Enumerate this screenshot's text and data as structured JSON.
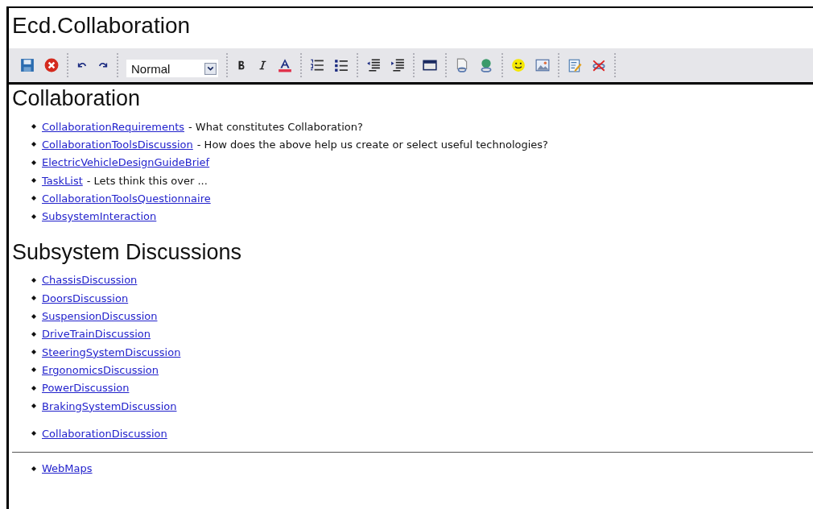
{
  "title": "Ecd.Collaboration",
  "toolbar": [
    [
      {
        "kind": "save"
      },
      {
        "kind": "cancel"
      }
    ],
    [
      {
        "kind": "undo"
      },
      {
        "kind": "redo"
      }
    ],
    [
      {
        "kind": "select",
        "value": "Normal"
      }
    ],
    [
      {
        "kind": "bold"
      },
      {
        "kind": "italic"
      },
      {
        "kind": "color"
      }
    ],
    [
      {
        "kind": "ordered"
      },
      {
        "kind": "unordered"
      }
    ],
    [
      {
        "kind": "outdent"
      },
      {
        "kind": "indent"
      }
    ],
    [
      {
        "kind": "table"
      }
    ],
    [
      {
        "kind": "link"
      },
      {
        "kind": "weblink"
      }
    ],
    [
      {
        "kind": "smiley"
      },
      {
        "kind": "image"
      }
    ],
    [
      {
        "kind": "edit"
      },
      {
        "kind": "unlink"
      }
    ]
  ],
  "sections": [
    {
      "heading": "Collaboration",
      "lists": [
        [
          {
            "link": "CollaborationRequirements",
            "description": "- What constitutes Collaboration?"
          },
          {
            "link": "CollaborationToolsDiscussion",
            "description": "- How does the above help us create or select useful technologies?"
          },
          {
            "link": "ElectricVehicleDesignGuideBrief"
          },
          {
            "link": "TaskList",
            "description": "- Lets think this over ..."
          },
          {
            "link": "CollaborationToolsQuestionnaire"
          },
          {
            "link": "SubsystemInteraction"
          }
        ]
      ]
    },
    {
      "heading": "Subsystem Discussions",
      "lists": [
        [
          {
            "link": "ChassisDiscussion"
          },
          {
            "link": "DoorsDiscussion"
          },
          {
            "link": "SuspensionDiscussion"
          },
          {
            "link": "DriveTrainDiscussion"
          },
          {
            "link": "SteeringSystemDiscussion"
          },
          {
            "link": "ErgonomicsDiscussion"
          },
          {
            "link": "PowerDiscussion"
          },
          {
            "link": "BrakingSystemDiscussion"
          }
        ],
        [
          {
            "link": "CollaborationDiscussion"
          }
        ]
      ]
    }
  ],
  "footer_list": [
    {
      "link": "WebMaps"
    }
  ]
}
